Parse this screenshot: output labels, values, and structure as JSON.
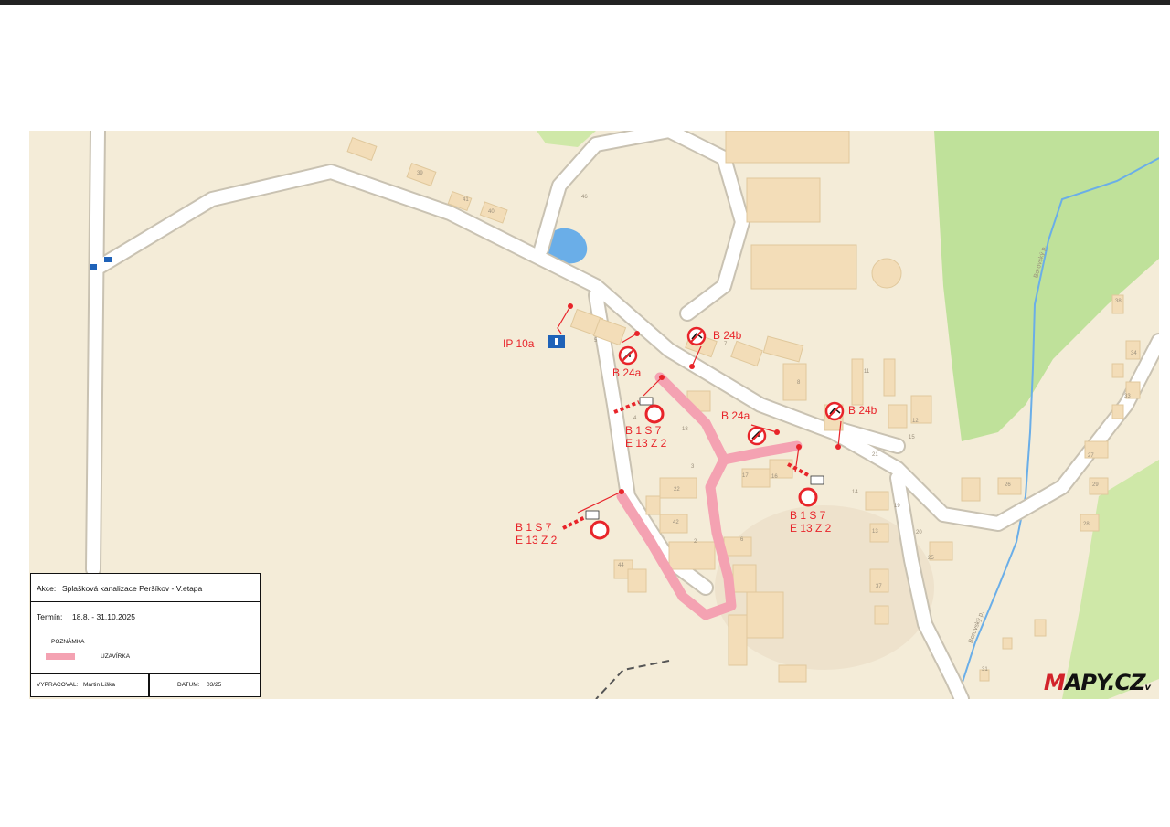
{
  "map": {
    "logo": {
      "mark": "M",
      "rest": "APY.CZ",
      "suffix": "v"
    },
    "colors": {
      "closure": "#f4a2b2",
      "sign_red": "#e8242a",
      "road": "#ffffff",
      "forest": "#bfe19a",
      "water": "#6aaee8",
      "building": "#f3ddb8"
    },
    "icons": [
      "no-turn-left-sign-icon",
      "no-entry-sign-icon",
      "barrier-icon",
      "info-sign-icon",
      "bus-stop-icon"
    ],
    "sign_labels": {
      "ip10a": "IP 10a",
      "b24a_1": "B 24a",
      "b24a_2": "B 24a",
      "b24b_1": "B 24b",
      "b24b_2": "B 24b",
      "g1_l1": "B 1   S 7",
      "g1_l2": "E 13 Z 2",
      "g2_l1": "B 1   S 7",
      "g2_l2": "E 13 Z 2",
      "g3_l1": "B 1   S 7",
      "g3_l2": "E 13 Z 2"
    },
    "stream_labels": [
      "Borovský p.",
      "Borovský p."
    ],
    "house_numbers": [
      "39",
      "41",
      "40",
      "46",
      "7",
      "8",
      "11",
      "12",
      "15",
      "38",
      "34",
      "33",
      "27",
      "29",
      "28",
      "26",
      "19",
      "20",
      "25",
      "14",
      "13",
      "17",
      "16",
      "18",
      "3",
      "22",
      "42",
      "2",
      "6",
      "44",
      "37",
      "31",
      "4",
      "5",
      "21"
    ]
  },
  "legend": {
    "akce_label": "Akce:",
    "akce_value": "Splašková kanalizace Peršíkov - V.etapa",
    "termin_label": "Termín:",
    "termin_value": "18.8. - 31.10.2025",
    "poznamka": "POZNÁMKA",
    "uzavirka": "UZAVÍRKA",
    "vypracoval_label": "VYPRACOVAL:",
    "vypracoval_value": "Martin Liška",
    "datum_label": "DATUM:",
    "datum_value": "03/25"
  }
}
